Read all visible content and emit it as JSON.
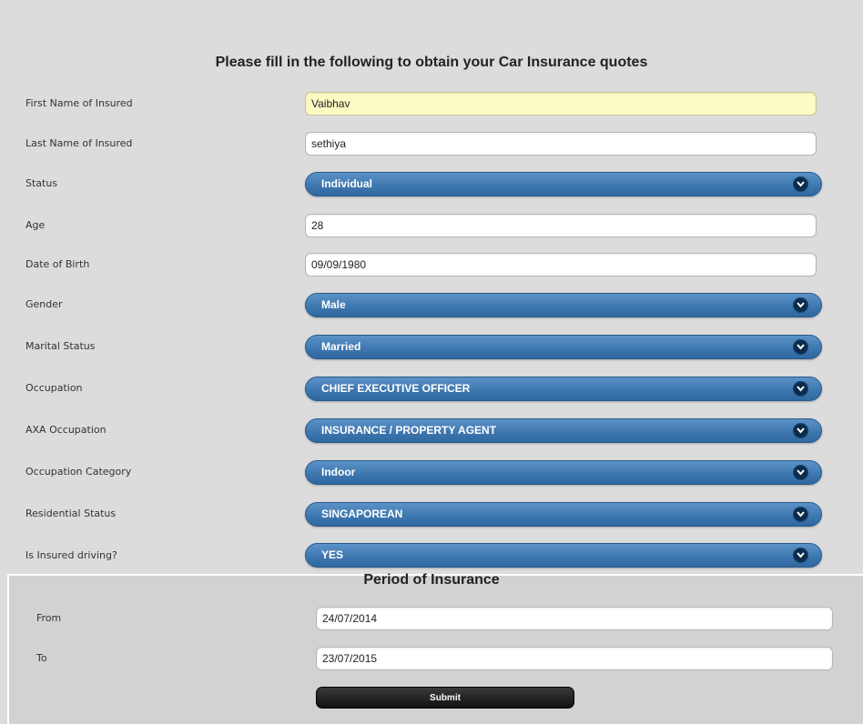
{
  "form": {
    "title": "Please fill in the following to obtain your Car Insurance quotes",
    "fields": [
      {
        "label": "First Name of Insured",
        "kind": "input",
        "value": "Vaibhav"
      },
      {
        "label": "Last Name of Insured",
        "kind": "input",
        "value": "sethiya"
      },
      {
        "label": "Status",
        "kind": "select",
        "value": "Individual"
      },
      {
        "label": "Age",
        "kind": "input",
        "value": "28"
      },
      {
        "label": "Date of Birth",
        "kind": "input",
        "value": "09/09/1980"
      },
      {
        "label": "Gender",
        "kind": "select",
        "value": "Male"
      },
      {
        "label": "Marital Status",
        "kind": "select",
        "value": "Married"
      },
      {
        "label": "Occupation",
        "kind": "select",
        "value": "CHIEF EXECUTIVE OFFICER"
      },
      {
        "label": "AXA Occupation",
        "kind": "select",
        "value": "INSURANCE / PROPERTY AGENT"
      },
      {
        "label": "Occupation Category",
        "kind": "select",
        "value": "Indoor"
      },
      {
        "label": "Residential Status",
        "kind": "select",
        "value": "SINGAPOREAN"
      },
      {
        "label": "Is Insured driving?",
        "kind": "select",
        "value": "YES"
      }
    ]
  },
  "period": {
    "title": "Period of Insurance",
    "from_label": "From",
    "from_value": "24/07/2014",
    "to_label": "To",
    "to_value": "23/07/2015",
    "submit_label": "Submit"
  },
  "colors": {
    "select_blue": "#3f78b0",
    "highlight_input": "#fdfbc4",
    "page_bg": "#dcdcdc"
  }
}
